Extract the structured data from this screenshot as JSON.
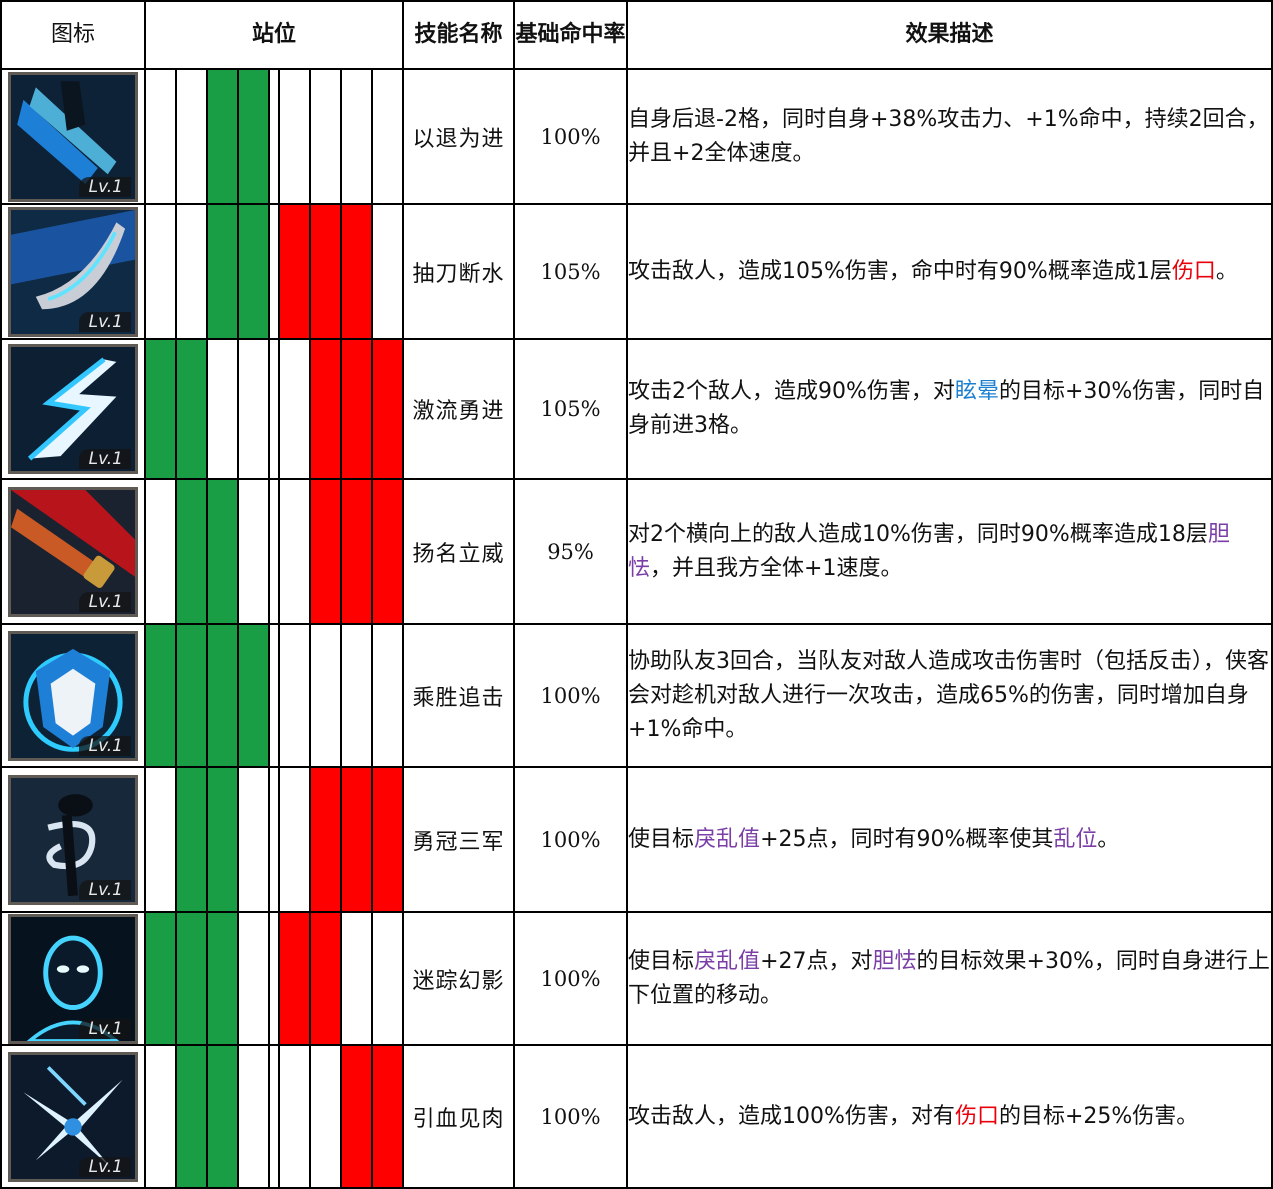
{
  "headers": {
    "icon": "图标",
    "position": "站位",
    "skill_name": "技能名称",
    "hit_rate": "基础命中率",
    "effect": "效果描述"
  },
  "colors": {
    "ally_active": "#1a9e45",
    "enemy_active": "#ff0000",
    "keyword_red": "#e8000b",
    "keyword_blue": "#1c7fcf",
    "keyword_purple": "#7a3ea6"
  },
  "skills": [
    {
      "icon_name": "blue-blade-retreat-icon",
      "level": "Lv.1",
      "ally": [
        0,
        0,
        1,
        1
      ],
      "enemy": [
        0,
        0,
        0,
        0
      ],
      "name": "以退为进",
      "hit_rate": "100%",
      "desc": [
        {
          "text": "自身后退-2格，同时自身+38%攻击力、+1%命中，持续2回合，并且+2全体速度。",
          "style": "plain"
        }
      ]
    },
    {
      "icon_name": "blade-draw-icon",
      "level": "Lv.1",
      "ally": [
        0,
        0,
        1,
        1
      ],
      "enemy": [
        1,
        1,
        1,
        0
      ],
      "name": "抽刀断水",
      "hit_rate": "105%",
      "desc": [
        {
          "text": "攻击敌人，造成105%伤害，命中时有90%概率造成1层",
          "style": "plain"
        },
        {
          "text": "伤口",
          "style": "red"
        },
        {
          "text": "。",
          "style": "plain"
        }
      ]
    },
    {
      "icon_name": "lightning-slash-icon",
      "level": "Lv.1",
      "ally": [
        1,
        1,
        0,
        0
      ],
      "enemy": [
        0,
        1,
        1,
        1
      ],
      "name": "激流勇进",
      "hit_rate": "105%",
      "desc": [
        {
          "text": "攻击2个敌人，造成90%伤害，对",
          "style": "plain"
        },
        {
          "text": "眩晕",
          "style": "blue"
        },
        {
          "text": "的目标+30%伤害，同时自身前进3格。",
          "style": "plain"
        }
      ]
    },
    {
      "icon_name": "saber-hilt-icon",
      "level": "Lv.1",
      "ally": [
        0,
        1,
        1,
        0
      ],
      "enemy": [
        0,
        1,
        1,
        1
      ],
      "name": "扬名立威",
      "hit_rate": "95%",
      "desc": [
        {
          "text": "对2个横向上的敌人造成10%伤害，同时90%概率造成18层",
          "style": "plain"
        },
        {
          "text": "胆怯",
          "style": "purple"
        },
        {
          "text": "，并且我方全体+1速度。",
          "style": "plain"
        }
      ]
    },
    {
      "icon_name": "shield-emblem-icon",
      "level": "Lv.1",
      "ally": [
        1,
        1,
        1,
        1
      ],
      "enemy": [
        0,
        0,
        0,
        0
      ],
      "name": "乘胜追击",
      "hit_rate": "100%",
      "desc": [
        {
          "text": "协助队友3回合，当队友对敌人造成攻击伤害时（包括反击），侠客会对趁机对敌人进行一次攻击，造成65%的伤害，同时增加自身+1%命中。",
          "style": "plain"
        }
      ]
    },
    {
      "icon_name": "swirling-warrior-icon",
      "level": "Lv.1",
      "ally": [
        0,
        1,
        1,
        0
      ],
      "enemy": [
        0,
        1,
        1,
        1
      ],
      "name": "勇冠三军",
      "hit_rate": "100%",
      "desc": [
        {
          "text": "使目标",
          "style": "plain"
        },
        {
          "text": "戾乱值",
          "style": "purple"
        },
        {
          "text": "+25点，同时有90%概率使其",
          "style": "plain"
        },
        {
          "text": "乱位",
          "style": "purple"
        },
        {
          "text": "。",
          "style": "plain"
        }
      ]
    },
    {
      "icon_name": "phantom-head-icon",
      "level": "Lv.1",
      "ally": [
        1,
        1,
        1,
        0
      ],
      "enemy": [
        1,
        1,
        0,
        0
      ],
      "name": "迷踪幻影",
      "hit_rate": "100%",
      "desc": [
        {
          "text": "使目标",
          "style": "plain"
        },
        {
          "text": "戾乱值",
          "style": "purple"
        },
        {
          "text": "+27点，对",
          "style": "plain"
        },
        {
          "text": "胆怯",
          "style": "purple"
        },
        {
          "text": "的目标效果+30%，同时自身进行上下位置的移动。",
          "style": "plain"
        }
      ]
    },
    {
      "icon_name": "blood-burst-icon",
      "level": "Lv.1",
      "ally": [
        0,
        1,
        1,
        0
      ],
      "enemy": [
        0,
        0,
        1,
        1
      ],
      "name": "引血见肉",
      "hit_rate": "100%",
      "desc": [
        {
          "text": "攻击敌人，造成100%伤害，对有",
          "style": "plain"
        },
        {
          "text": "伤口",
          "style": "red"
        },
        {
          "text": "的目标+25%伤害。",
          "style": "plain"
        }
      ]
    }
  ]
}
